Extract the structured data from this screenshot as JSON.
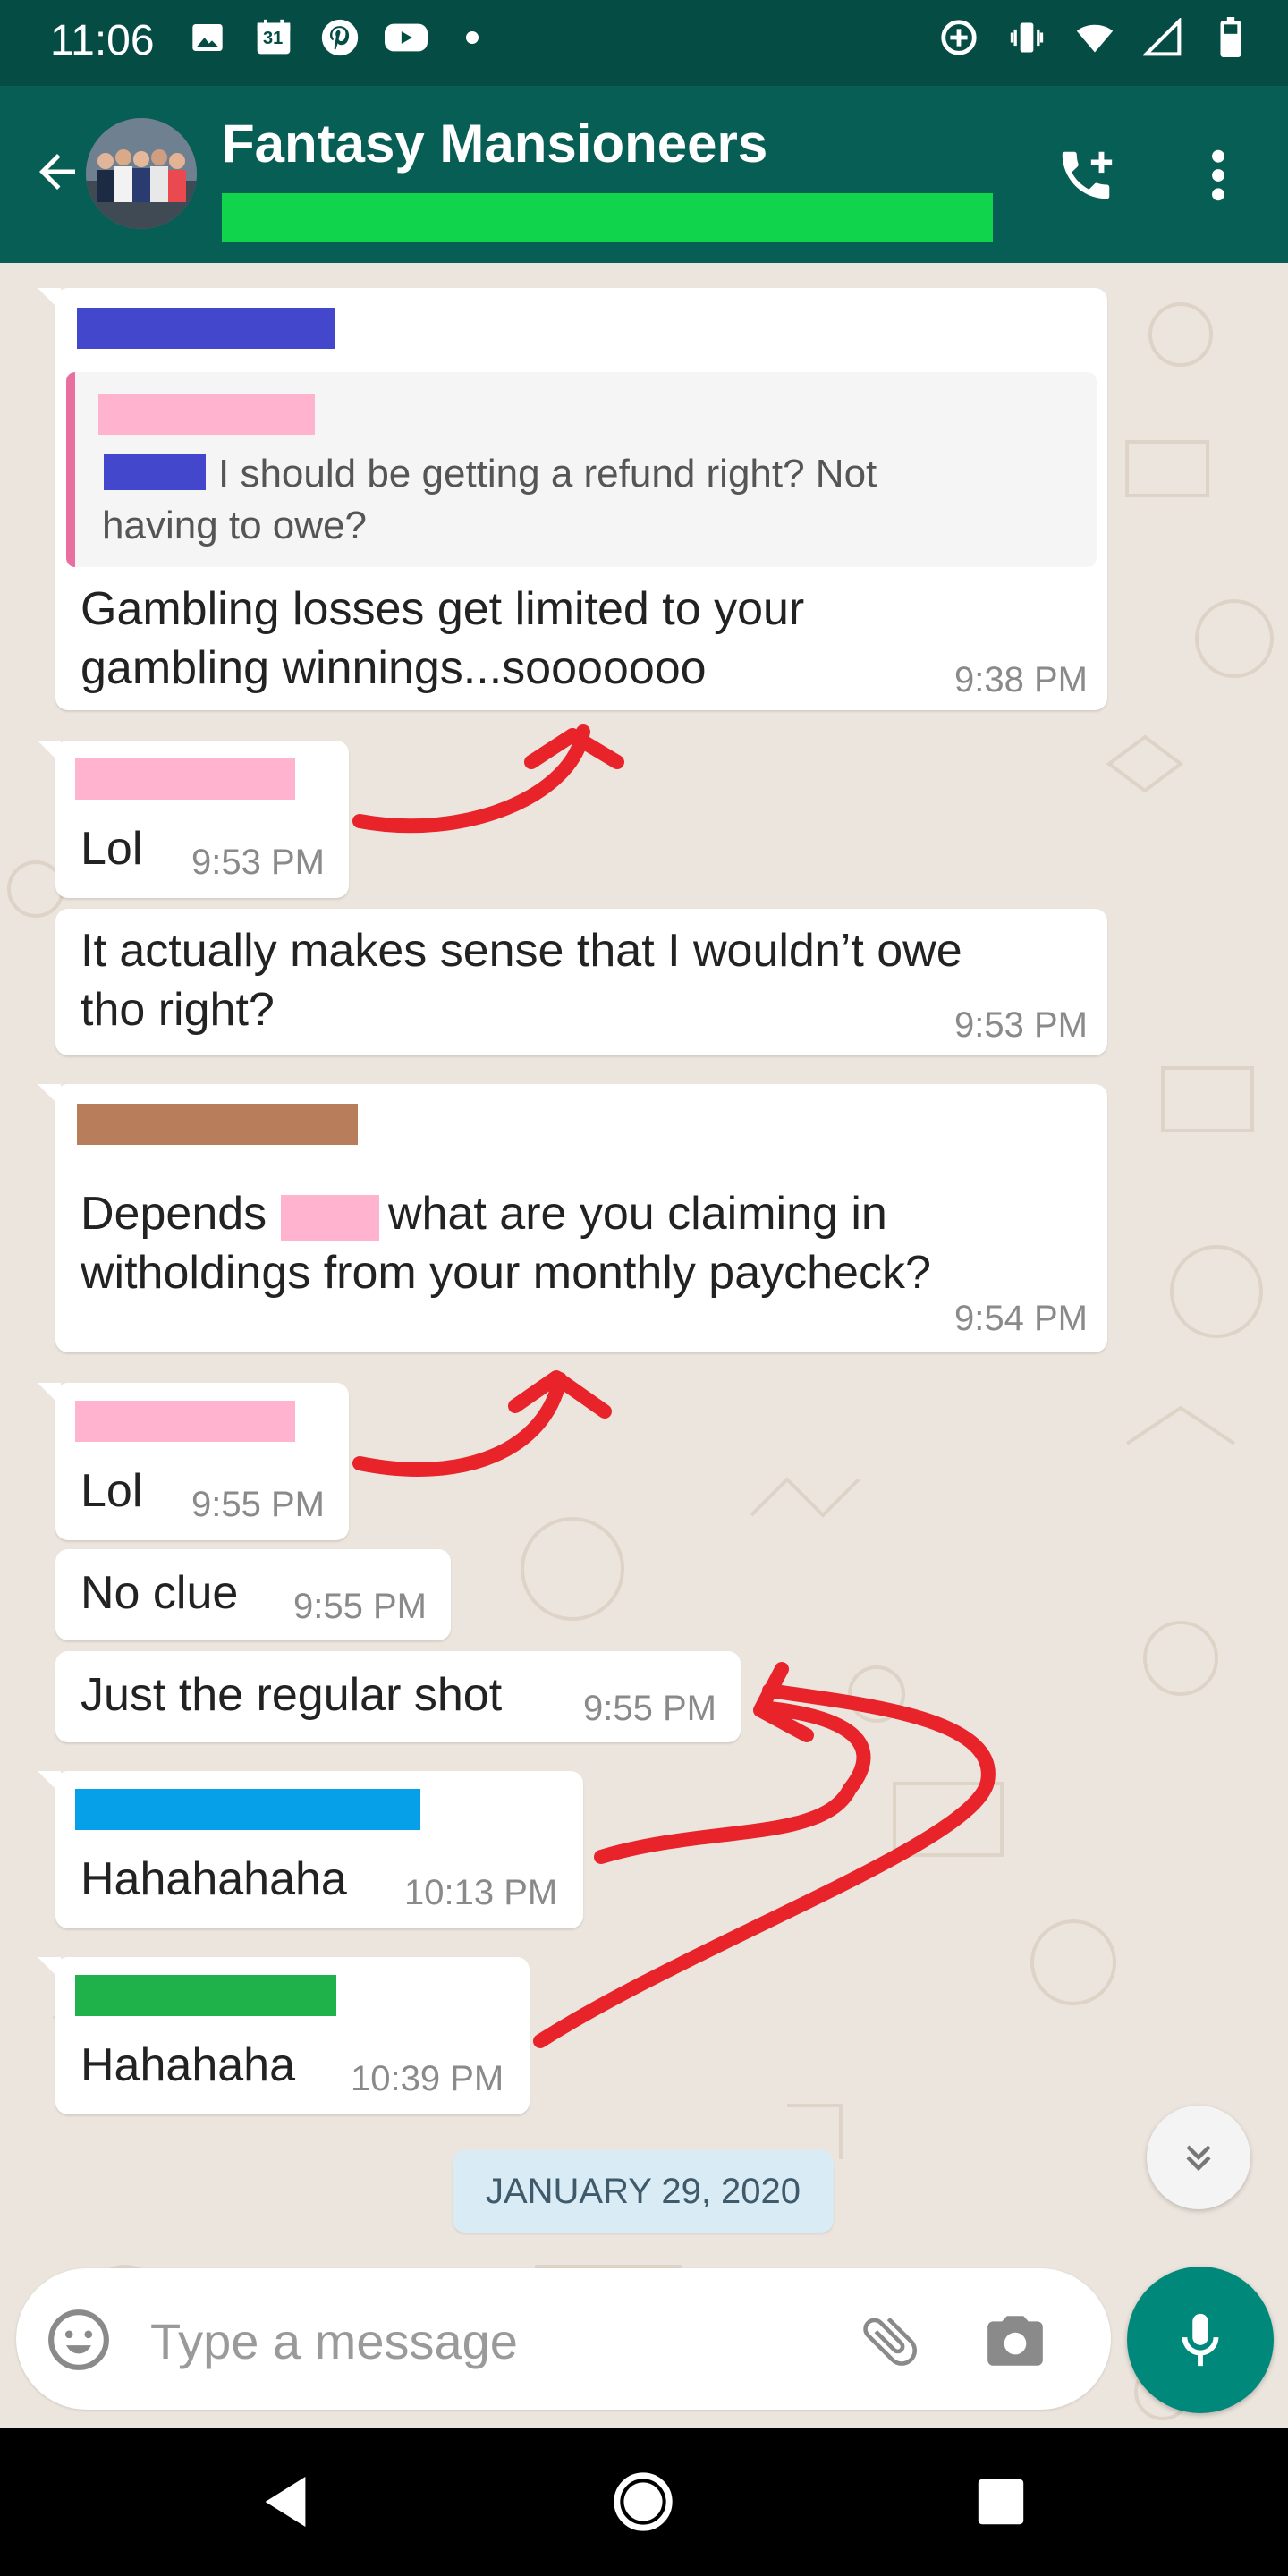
{
  "status_bar": {
    "time": "11:06",
    "calendar_day": "31"
  },
  "header": {
    "title": "Fantasy Mansioneers",
    "subtitle_redaction_color": "#10d44c"
  },
  "messages": [
    {
      "sender_color": "#4347cc",
      "quote": {
        "author_color": "#ffb3cf",
        "inline_color": "#4347cc",
        "text_line1": "I should be getting a refund right? Not",
        "text_line2": "having to owe?"
      },
      "line1": "Gambling losses get limited to your",
      "line2": "gambling winnings...sooooooo",
      "time": "9:38 PM"
    },
    {
      "sender_color": "#ffb3cf",
      "text": "Lol",
      "time": "9:53 PM"
    },
    {
      "line1": "It actually makes sense that I wouldn’t owe",
      "line2": "tho right?",
      "time": "9:53 PM"
    },
    {
      "sender_color": "#b87d5a",
      "line1_a": "Depends",
      "inline_color": "#ffb3cf",
      "line1_b": "what are you claiming in",
      "line2": "witholdings from your monthly paycheck?",
      "time": "9:54 PM"
    },
    {
      "sender_color": "#ffb3cf",
      "text": "Lol",
      "time": "9:55 PM"
    },
    {
      "text": "No clue",
      "time": "9:55 PM"
    },
    {
      "text": "Just the regular shot",
      "time": "9:55 PM"
    },
    {
      "sender_color": "#05a0e8",
      "text": "Hahahahaha",
      "time": "10:13 PM"
    },
    {
      "sender_color": "#20b24a",
      "text": "Hahahaha",
      "time": "10:39 PM"
    }
  ],
  "date_chip": "JANUARY 29, 2020",
  "composer": {
    "placeholder": "Type a message"
  },
  "colors": {
    "header_bg": "#075e54",
    "statusbar_bg": "#054d44",
    "mic_bg": "#00897b",
    "annotation_red": "#e8232a"
  }
}
